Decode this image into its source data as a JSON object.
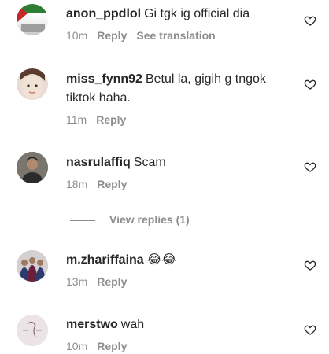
{
  "comments": [
    {
      "user": "anon_ppdlol",
      "text": "Gi tgk ig official dia",
      "time": "10m",
      "reply": "Reply",
      "translate": "See translation"
    },
    {
      "user": "miss_fynn92",
      "text": "Betul la, gigih g tngok tiktok haha.",
      "time": "11m",
      "reply": "Reply"
    },
    {
      "user": "nasrulaffiq",
      "text": "Scam",
      "time": "18m",
      "reply": "Reply"
    },
    {
      "user": "m.zhariffaina",
      "text": "😂😂",
      "time": "13m",
      "reply": "Reply"
    },
    {
      "user": "merstwo",
      "text": "wah",
      "time": "10m",
      "reply": "Reply"
    }
  ],
  "view_replies": "View replies (1)",
  "icons": {
    "like": "heart-icon"
  },
  "colors": {
    "text": "#262626",
    "secondary": "#8e8e8e"
  }
}
